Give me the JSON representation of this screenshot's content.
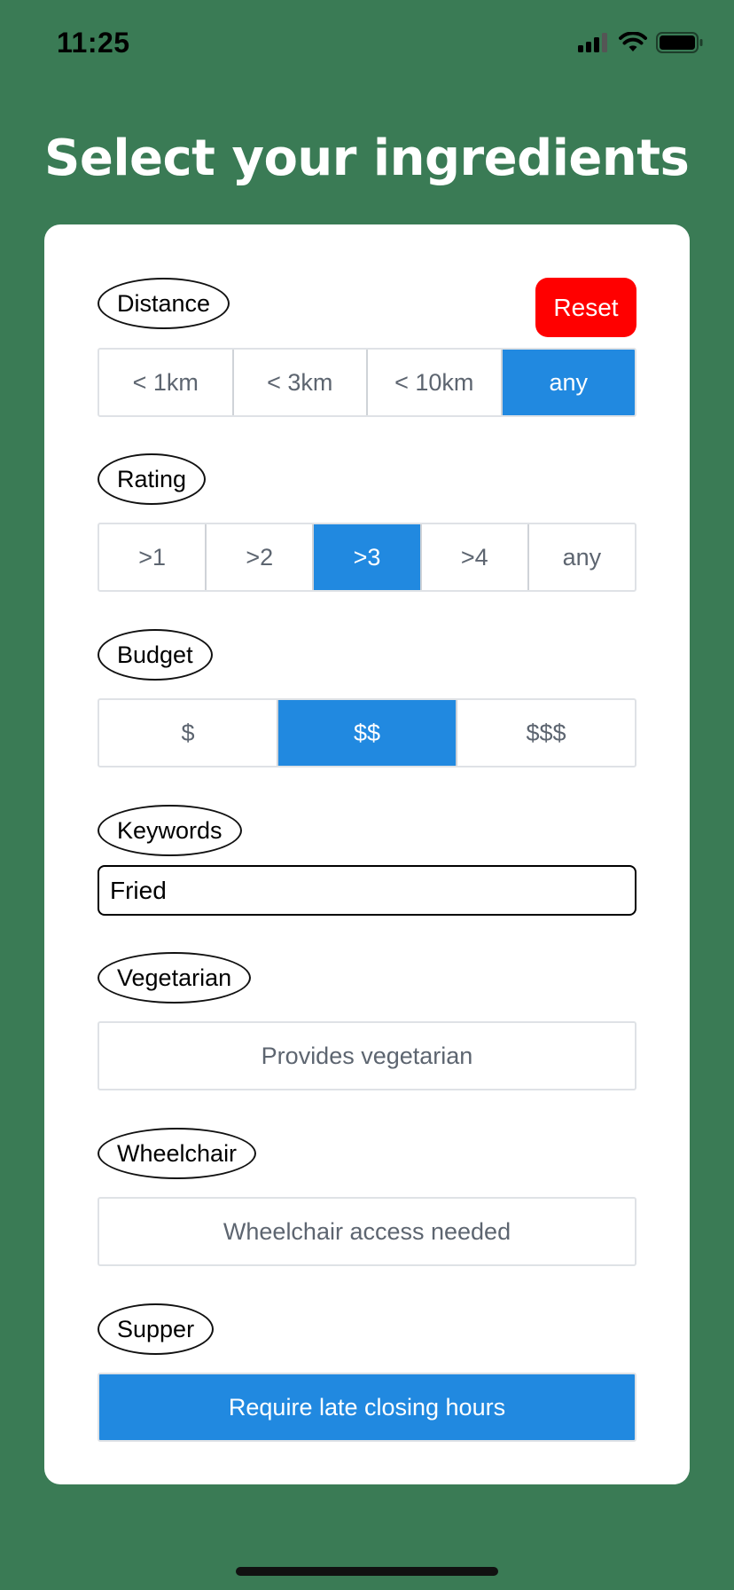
{
  "status_bar": {
    "time": "11:25",
    "icons": [
      "signal-icon",
      "wifi-icon",
      "battery-icon"
    ]
  },
  "page": {
    "title": "Select your ingredients"
  },
  "filters": {
    "reset_label": "Reset",
    "distance": {
      "label": "Distance",
      "options": [
        "< 1km",
        "< 3km",
        "< 10km",
        "any"
      ],
      "selected": "any"
    },
    "rating": {
      "label": "Rating",
      "options": [
        ">1",
        ">2",
        ">3",
        ">4",
        "any"
      ],
      "selected": ">3"
    },
    "budget": {
      "label": "Budget",
      "options": [
        "$",
        "$$",
        "$$$"
      ],
      "selected": "$$"
    },
    "keywords": {
      "label": "Keywords",
      "value": "Fried"
    },
    "vegetarian": {
      "label": "Vegetarian",
      "toggle_text": "Provides vegetarian",
      "active": false
    },
    "wheelchair": {
      "label": "Wheelchair",
      "toggle_text": "Wheelchair access needed",
      "active": false
    },
    "supper": {
      "label": "Supper",
      "toggle_text": "Require late closing hours",
      "active": true
    }
  },
  "colors": {
    "background": "#3a7b55",
    "accent": "#2189e0",
    "reset": "#ff0000"
  }
}
